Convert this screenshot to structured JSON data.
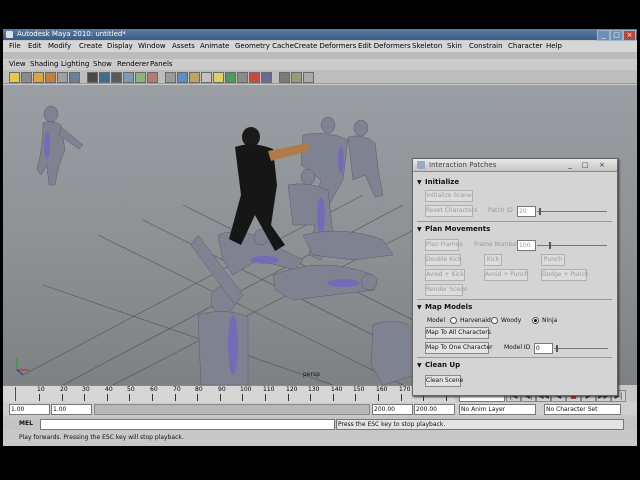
{
  "window": {
    "title": "Autodesk Maya 2010: untitled*",
    "controls": [
      "_",
      "□",
      "×"
    ]
  },
  "menubar": [
    "File",
    "Edit",
    "Modify",
    "Create",
    "Display",
    "Window",
    "Assets",
    "Animate",
    "Geometry Cache",
    "Create Deformers",
    "Edit Deformers",
    "Skeleton",
    "Skin",
    "Constrain",
    "Character",
    "Help"
  ],
  "panel_menu": [
    "View",
    "Shading",
    "Lighting",
    "Show",
    "Renderer",
    "Panels"
  ],
  "viewport": {
    "camera_label": "persp"
  },
  "timeline": {
    "ticks": [
      "10",
      "20",
      "30",
      "40",
      "50",
      "60",
      "70",
      "80",
      "90",
      "100",
      "110",
      "120",
      "130",
      "140",
      "150",
      "160",
      "170",
      "180",
      "190",
      "2"
    ],
    "current_frame": "16.00"
  },
  "playback_buttons": [
    "|◀",
    "◀|",
    "◀◀",
    "◀",
    "■",
    "▶",
    "▶▶",
    "▶|"
  ],
  "range_bar": {
    "start": "1.00",
    "playback_start": "1.00",
    "playback_end": "200.00",
    "end": "200.00",
    "anim_layer": "No Anim Layer",
    "character_set": "No Character Set"
  },
  "command_line": {
    "label": "MEL",
    "result": "Press the ESC key to stop playback."
  },
  "help_line": "Play forwards. Pressing the ESC key will stop playback.",
  "dialog": {
    "title": "Interaction Patches",
    "sections": {
      "initialize": {
        "title": "Initialize",
        "init_scene": "Initialize Scene",
        "reset_characters": "Reset Characters",
        "patch_id_label": "Patch ID",
        "patch_id_value": "20"
      },
      "plan": {
        "title": "Plan Movements",
        "plan_frames": "Plan Frames",
        "frame_number_label": "Frame Number",
        "frame_number_value": "100",
        "double_kick": "Double Kick",
        "kick": "Kick",
        "punch": "Punch",
        "avoid_kick": "Avoid + Kick",
        "avoid_punch": "Avoid + Punch",
        "dodge_punch": "Dodge + Punch",
        "render_scene": "Render Scene"
      },
      "map": {
        "title": "Map Models",
        "model_label": "Model",
        "options": [
          "Harvenaid",
          "Woody",
          "Ninja"
        ],
        "selected": "Ninja",
        "map_all": "Map To All Characters",
        "map_one": "Map To One Character",
        "model_id_label": "Model ID",
        "model_id_value": "0"
      },
      "cleanup": {
        "title": "Clean Up",
        "clean_scene": "Clean Scene"
      }
    }
  }
}
